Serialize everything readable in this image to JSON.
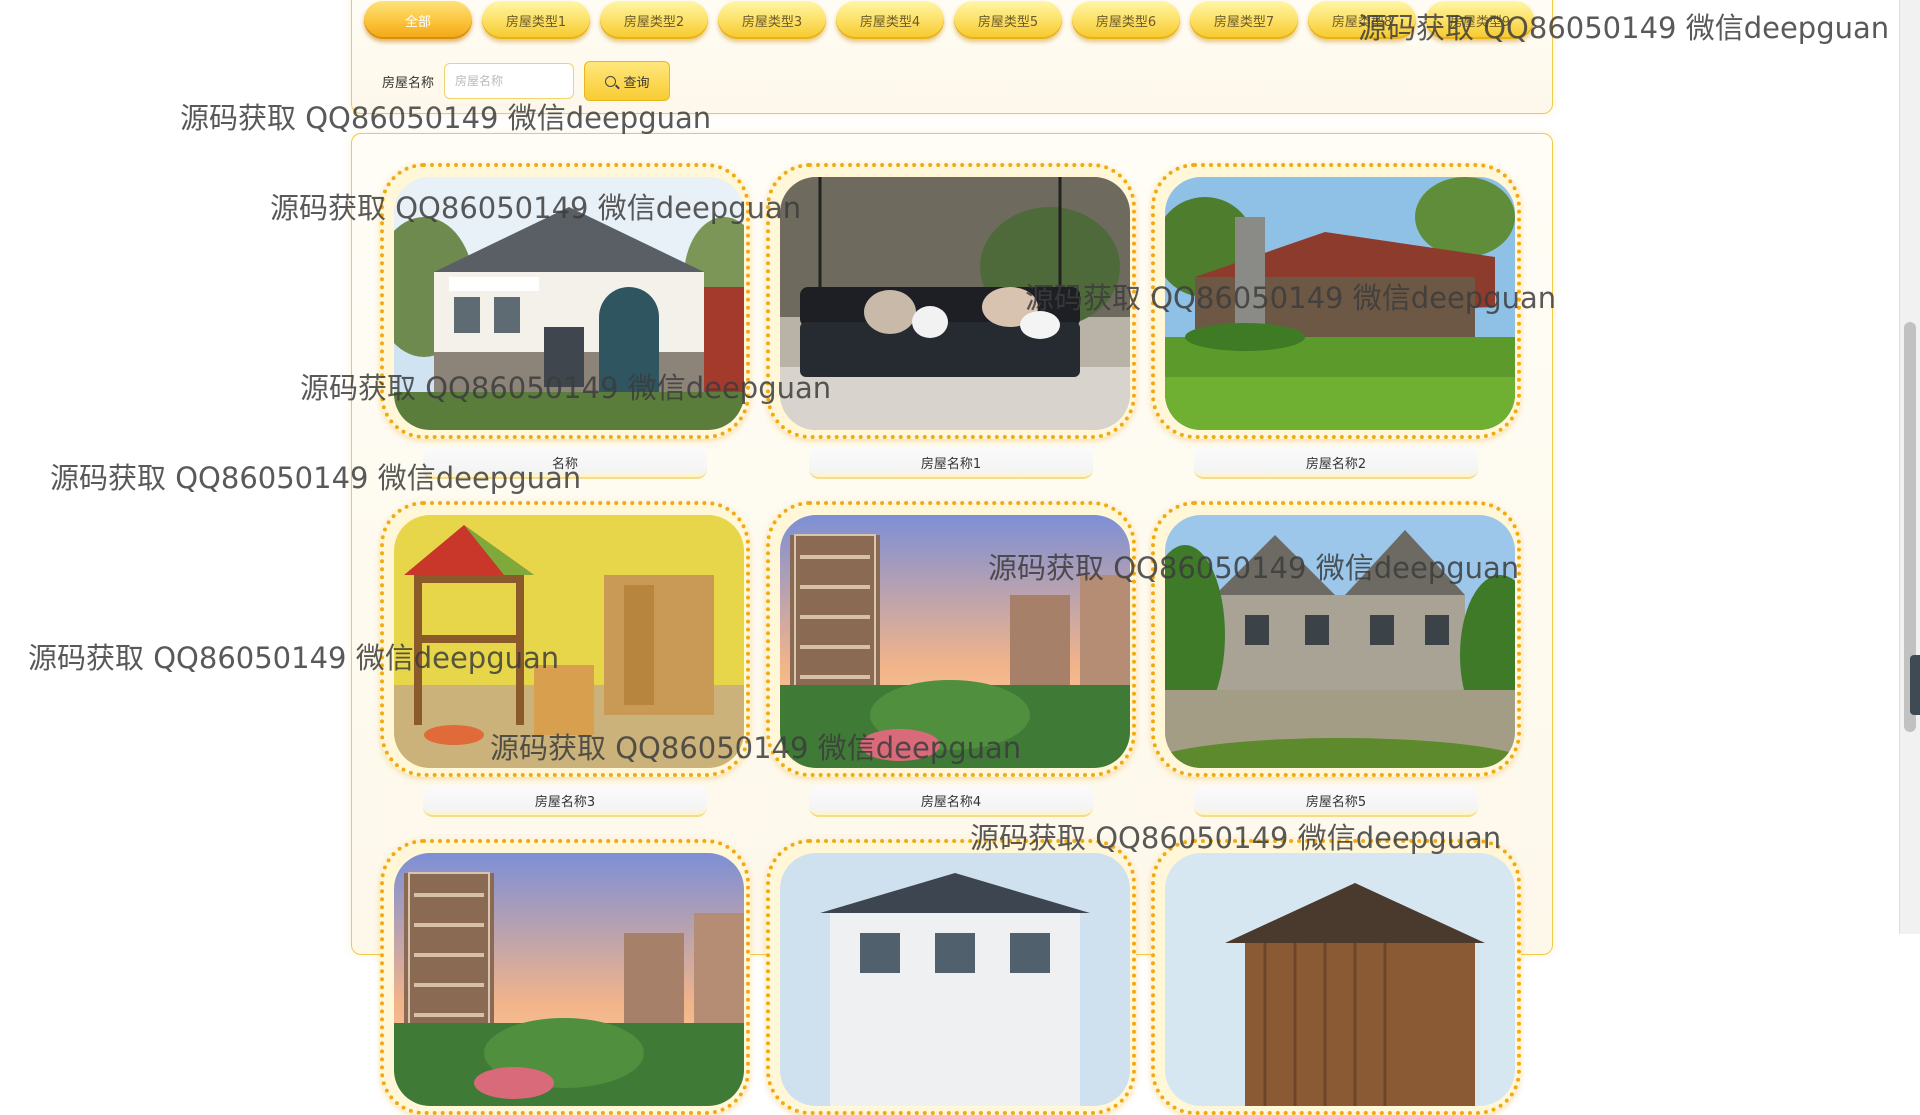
{
  "filter": {
    "tabs": [
      "全部",
      "房屋类型1",
      "房屋类型2",
      "房屋类型3",
      "房屋类型4",
      "房屋类型5",
      "房屋类型6",
      "房屋类型7",
      "房屋类型8",
      "房屋类型9"
    ],
    "search_label": "房屋名称",
    "search_placeholder": "房屋名称",
    "search_button": "查询"
  },
  "houses": [
    {
      "name": "名称",
      "scene": "white-villa"
    },
    {
      "name": "房屋名称1",
      "scene": "porch-swing"
    },
    {
      "name": "房屋名称2",
      "scene": "log-cabin"
    },
    {
      "name": "房屋名称3",
      "scene": "kids-bedroom"
    },
    {
      "name": "房屋名称4",
      "scene": "apartment-sunset"
    },
    {
      "name": "房屋名称5",
      "scene": "stone-manor"
    },
    {
      "name": "",
      "scene": "apartment-sunset"
    },
    {
      "name": "",
      "scene": "modern-villa"
    },
    {
      "name": "",
      "scene": "wood-house"
    }
  ],
  "watermark": "源码获取 QQ86050149 微信deepguan",
  "colors": {
    "accent": "#f6c82a",
    "frame": "#f1aa17",
    "panel_border": "#f3c94a"
  }
}
